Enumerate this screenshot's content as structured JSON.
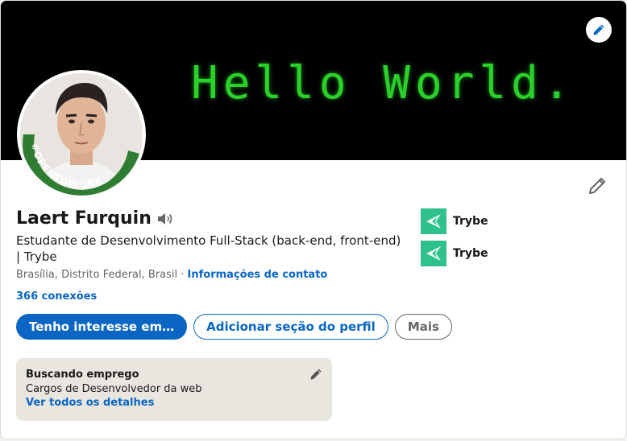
{
  "banner": {
    "text": "Hello World.",
    "edit_icon": "pencil-icon"
  },
  "profile": {
    "name": "Laert Furquin",
    "name_pronunciation_icon": "speaker-icon",
    "badge": "#OPENTOWORK",
    "headline": "Estudante de Desenvolvimento Full-Stack (back-end, front-end) | Trybe",
    "location": "Brasília, Distrito Federal, Brasil",
    "separator": " · ",
    "contact_info_link": "Informações de contato",
    "connections": "366 conexões",
    "edit_icon": "pencil-icon"
  },
  "actions": {
    "primary_label": "Tenho interesse em…",
    "add_section_label": "Adicionar seção do perfil",
    "more_label": "Mais"
  },
  "companies": [
    {
      "name": "Trybe",
      "logo_icon": "trybe-logo-icon"
    },
    {
      "name": "Trybe",
      "logo_icon": "trybe-logo-icon"
    }
  ],
  "open_to_work": {
    "title": "Buscando emprego",
    "description": "Cargos de Desenvolvedor da web",
    "details_link": "Ver todos os detalhes",
    "edit_icon": "pencil-icon"
  },
  "colors": {
    "accent_blue": "#0a66c2",
    "open_to_work_green": "#2f7d32",
    "banner_text_green": "#2bd12b",
    "trybe_green": "#2fc18c",
    "card_highlight_bg": "#e9e5df"
  }
}
